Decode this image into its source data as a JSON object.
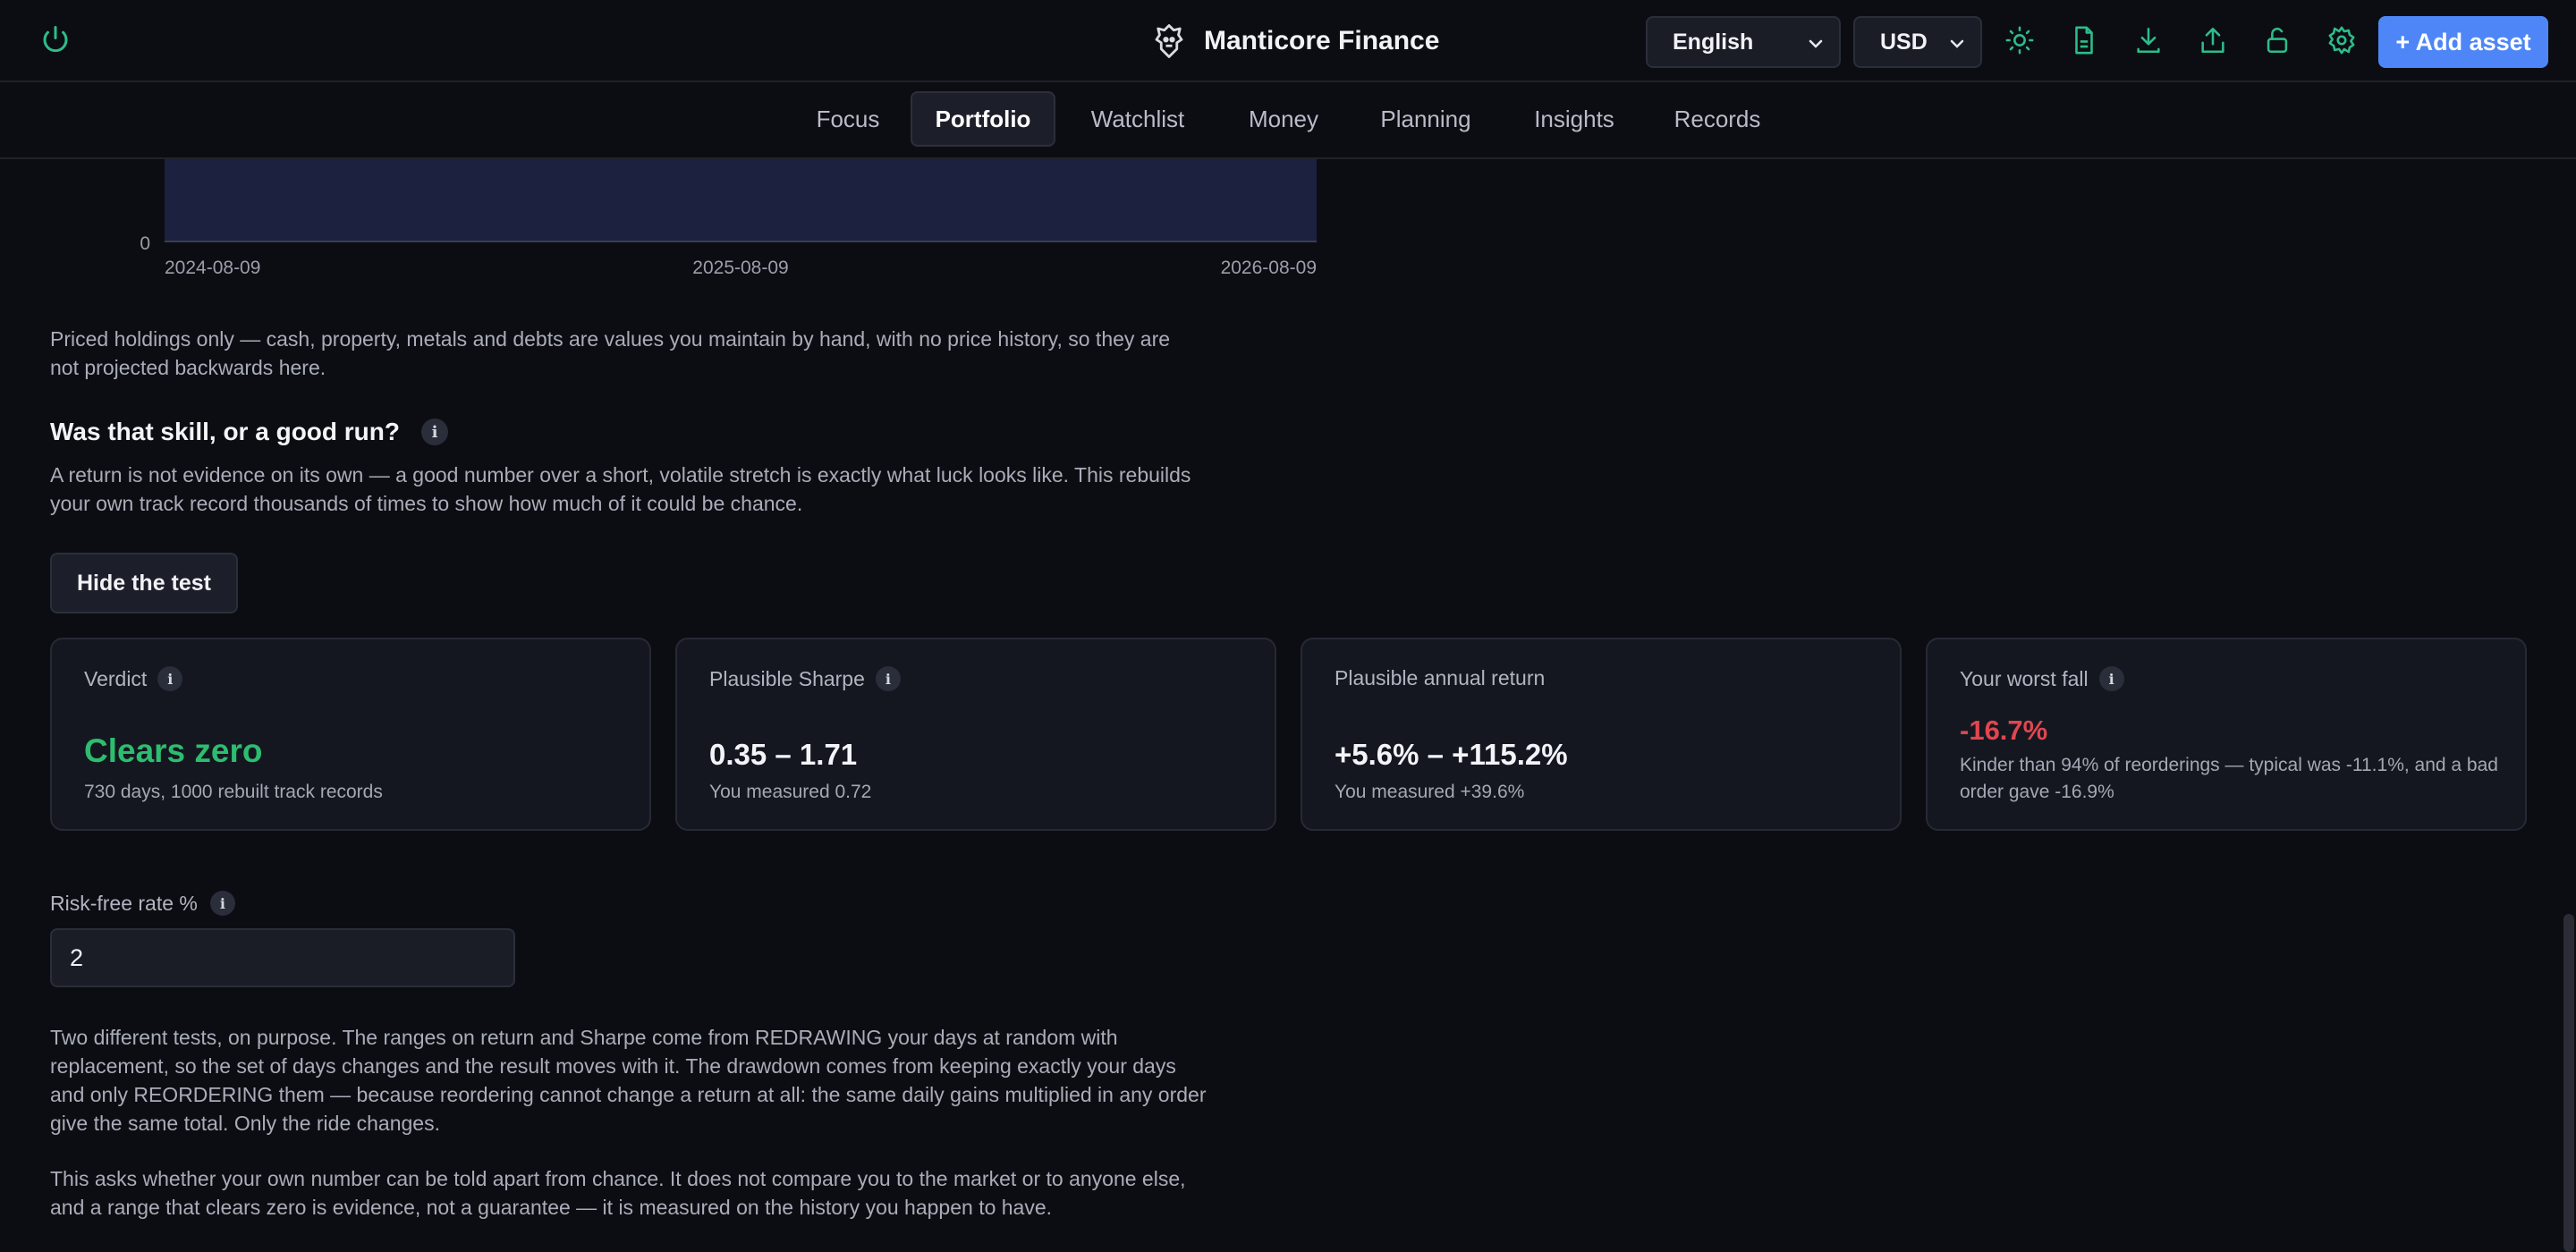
{
  "header": {
    "app_name": "Manticore Finance",
    "language": "English",
    "currency": "USD",
    "add_asset_label": "+ Add asset",
    "icons": [
      "power-icon",
      "sun-icon",
      "document-icon",
      "download-icon",
      "upload-icon",
      "unlock-icon",
      "gear-icon"
    ],
    "accent_color": "#2dbd8a",
    "primary_color": "#4f86f7"
  },
  "nav": {
    "tabs": [
      {
        "label": "Focus"
      },
      {
        "label": "Portfolio",
        "active": true
      },
      {
        "label": "Watchlist"
      },
      {
        "label": "Money"
      },
      {
        "label": "Planning"
      },
      {
        "label": "Insights"
      },
      {
        "label": "Records"
      }
    ]
  },
  "chart_data": {
    "type": "area",
    "x": [
      "2024-08-09",
      "2025-08-09",
      "2026-08-09"
    ],
    "y_tick_visible": "0",
    "fill_color": "#1c2140"
  },
  "main": {
    "priced_note": "Priced holdings only — cash, property, metals and debts are values you maintain by hand, with no price history, so they are not projected backwards here.",
    "skill_heading": "Was that skill, or a good run?",
    "skill_desc": "A return is not evidence on its own — a good number over a short, volatile stretch is exactly what luck looks like. This rebuilds your own track record thousands of times to show how much of it could be chance.",
    "hide_button": "Hide the test",
    "info_glyph": "i",
    "cards": [
      {
        "label": "Verdict",
        "value": "Clears zero",
        "sub": "730 days, 1000 rebuilt track records",
        "color": "#2dbd6e"
      },
      {
        "label": "Plausible Sharpe",
        "value": "0.35 – 1.71",
        "sub": "You measured 0.72"
      },
      {
        "label": "Plausible annual return",
        "value": "+5.6% – +115.2%",
        "sub": "You measured +39.6%"
      },
      {
        "label": "Your worst fall",
        "value": "-16.7%",
        "sub": "Kinder than 94% of reorderings — typical was -11.1%, and a bad order gave -16.9%",
        "color": "#e0464e"
      }
    ],
    "risk_free_label": "Risk-free rate %",
    "risk_free_value": "2",
    "two_tests_note": "Two different tests, on purpose. The ranges on return and Sharpe come from REDRAWING your days at random with replacement, so the set of days changes and the result moves with it. The drawdown comes from keeping exactly your days and only REORDERING them — because reordering cannot change a return at all: the same daily gains multiplied in any order give the same total. Only the ride changes.",
    "chance_note": "This asks whether your own number can be told apart from chance. It does not compare you to the market or to anyone else, and a range that clears zero is evidence, not a guarantee — it is measured on the history you happen to have."
  }
}
